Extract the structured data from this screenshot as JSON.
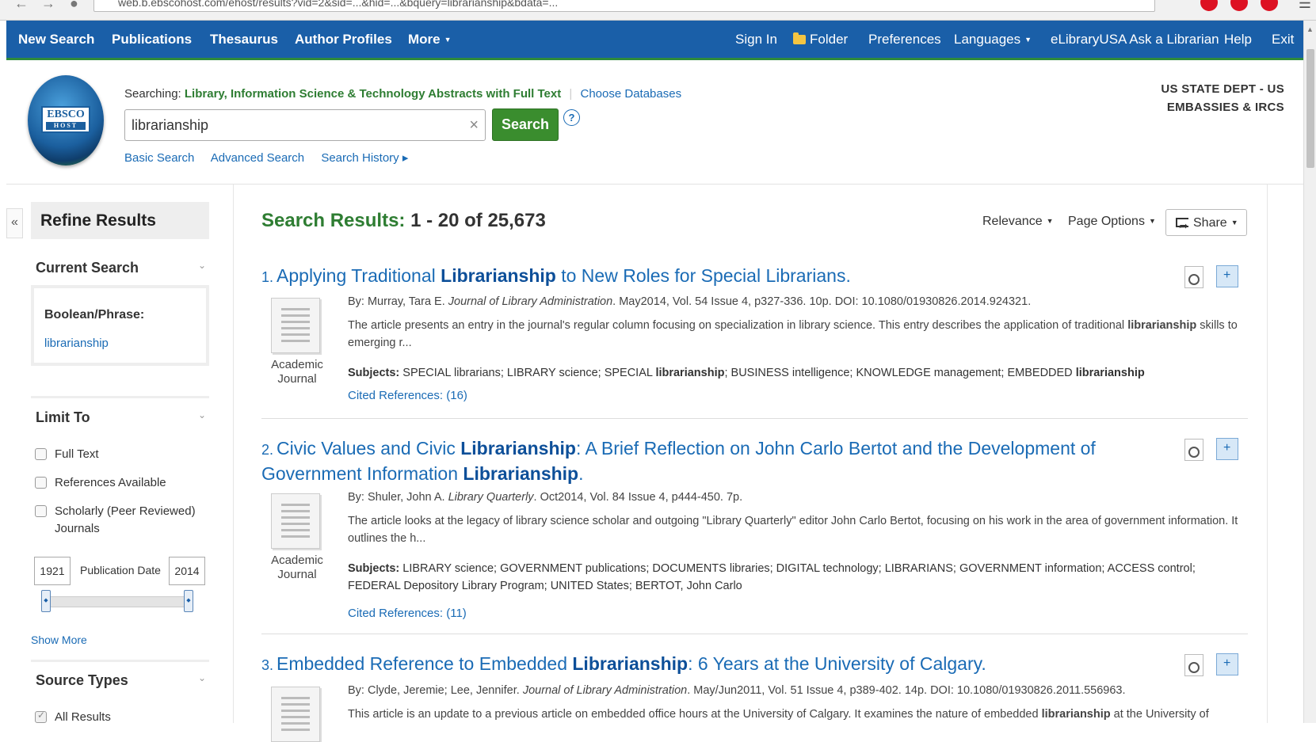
{
  "browser": {
    "url": "web.b.ebscohost.com/ehost/results?vid=2&sid=...&hid=...&bquery=librarianship&bdata=..."
  },
  "topnav": {
    "left": [
      "New Search",
      "Publications",
      "Thesaurus",
      "Author Profiles",
      "More"
    ],
    "right": {
      "sign_in": "Sign In",
      "folder": "Folder",
      "preferences": "Preferences",
      "languages": "Languages",
      "elibrary": "eLibraryUSA Ask a Librarian",
      "help": "Help",
      "exit": "Exit"
    }
  },
  "logo": {
    "line1": "EBSCO",
    "line2": "HOST"
  },
  "search": {
    "searching_label": "Searching:",
    "database": "Library, Information Science & Technology Abstracts with Full Text",
    "choose_databases": "Choose Databases",
    "query": "librarianship",
    "clear": "×",
    "button": "Search",
    "help": "?",
    "links": [
      "Basic Search",
      "Advanced Search",
      "Search History ▸"
    ]
  },
  "org": {
    "line1": "US STATE DEPT - US",
    "line2": "EMBASSIES & IRCS"
  },
  "sidebar": {
    "collapse": "«",
    "title": "Refine Results",
    "current_search": {
      "heading": "Current Search",
      "boolean_label": "Boolean/Phrase:",
      "term": "librarianship"
    },
    "limit_to": {
      "heading": "Limit To",
      "options": [
        {
          "label": "Full Text",
          "checked": false
        },
        {
          "label": "References Available",
          "checked": false
        },
        {
          "label": "Scholarly (Peer Reviewed) Journals",
          "checked": false
        }
      ],
      "year_from": "1921",
      "year_to": "2014",
      "pubdate_label": "Publication Date",
      "show_more": "Show More"
    },
    "source_types": {
      "heading": "Source Types",
      "options": [
        {
          "label": "All Results",
          "checked": true
        }
      ]
    }
  },
  "results": {
    "heading_label": "Search Results:",
    "heading_count": "1 - 20 of 25,673",
    "sort": "Relevance",
    "page_options": "Page Options",
    "share": "Share",
    "items": [
      {
        "num": "1.",
        "title_parts": [
          "Applying Traditional ",
          "Librarianship",
          " to New Roles for Special Librarians."
        ],
        "byline": "By: Murray, Tara E. ",
        "journal": "Journal of Library Administration",
        "details": ". May2014, Vol. 54 Issue 4, p327-336. 10p. DOI: 10.1080/01930826.2014.924321.",
        "abstract_parts": [
          "The article presents an entry in the journal's regular column focusing on specialization in library science. This entry describes the application of traditional ",
          "librarianship",
          " skills to emerging r..."
        ],
        "subjects_label": "Subjects:",
        "subjects_parts": [
          " SPECIAL librarians; LIBRARY science; SPECIAL ",
          "librarianship",
          "; BUSINESS intelligence; KNOWLEDGE management; EMBEDDED ",
          "librarianship"
        ],
        "cited": "Cited References: (16)",
        "doc_type": "Academic Journal"
      },
      {
        "num": "2.",
        "title_parts": [
          "Civic Values and Civic ",
          "Librarianship",
          ": A Brief Reflection on John Carlo Bertot and the Development of Government Information ",
          "Librarianship",
          "."
        ],
        "byline": "By: Shuler, John A. ",
        "journal": "Library Quarterly",
        "details": ". Oct2014, Vol. 84 Issue 4, p444-450. 7p.",
        "abstract_parts": [
          "The article looks at the legacy of library science scholar and outgoing \"Library Quarterly\" editor John Carlo Bertot, focusing on his work in the area of government information. It outlines the h..."
        ],
        "subjects_label": "Subjects:",
        "subjects_parts": [
          " LIBRARY science; GOVERNMENT publications; DOCUMENTS libraries; DIGITAL technology; LIBRARIANS; GOVERNMENT information; ACCESS control; FEDERAL Depository Library Program; UNITED States; BERTOT, John Carlo"
        ],
        "cited": "Cited References: (11)",
        "doc_type": "Academic Journal"
      },
      {
        "num": "3.",
        "title_parts": [
          "Embedded Reference to Embedded ",
          "Librarianship",
          ": 6 Years at the University of Calgary."
        ],
        "byline": "By: Clyde, Jeremie; Lee, Jennifer. ",
        "journal": "Journal of Library Administration",
        "details": ". May/Jun2011, Vol. 51 Issue 4, p389-402. 14p. DOI: 10.1080/01930826.2011.556963.",
        "abstract_parts": [
          "This article is an update to a previous article on embedded office hours at the University of Calgary. It examines the nature of embedded ",
          "librarianship",
          " at the University of"
        ]
      }
    ]
  }
}
